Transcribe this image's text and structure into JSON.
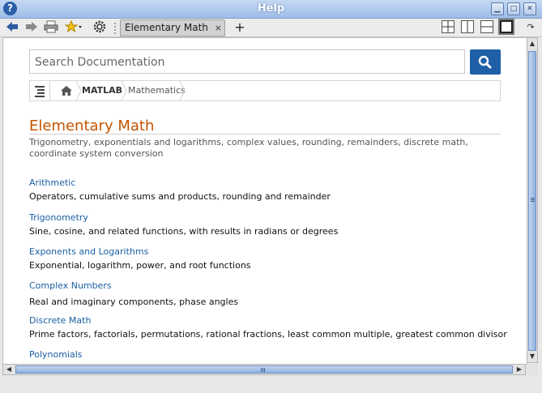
{
  "window": {
    "title": "Help"
  },
  "toolbar": {
    "tab_label": "Elementary Math",
    "tab_close": "×",
    "new_tab": "+"
  },
  "search": {
    "placeholder": "Search Documentation"
  },
  "breadcrumb": {
    "items": [
      "MATLAB",
      "Mathematics"
    ]
  },
  "page": {
    "title": "Elementary Math",
    "description": "Trigonometry, exponentials and logarithms, complex values, rounding, remainders, discrete math, coordinate system conversion"
  },
  "topics": [
    {
      "title": "Arithmetic",
      "description": "Operators, cumulative sums and products, rounding and remainder"
    },
    {
      "title": "Trigonometry",
      "description": "Sine, cosine, and related functions, with results in radians or degrees"
    },
    {
      "title": "Exponents and Logarithms",
      "description": "Exponential, logarithm, power, and root functions"
    },
    {
      "title": "Complex Numbers",
      "description": "Real and imaginary components, phase angles"
    },
    {
      "title": "Discrete Math",
      "description": "Prime factors, factorials, permutations, rational fractions, least common multiple, greatest common divisor"
    },
    {
      "title": "Polynomials",
      "description": ""
    }
  ],
  "colors": {
    "accent_title": "#c45400",
    "link": "#1a5fa3",
    "search_button": "#1f5fa6"
  }
}
